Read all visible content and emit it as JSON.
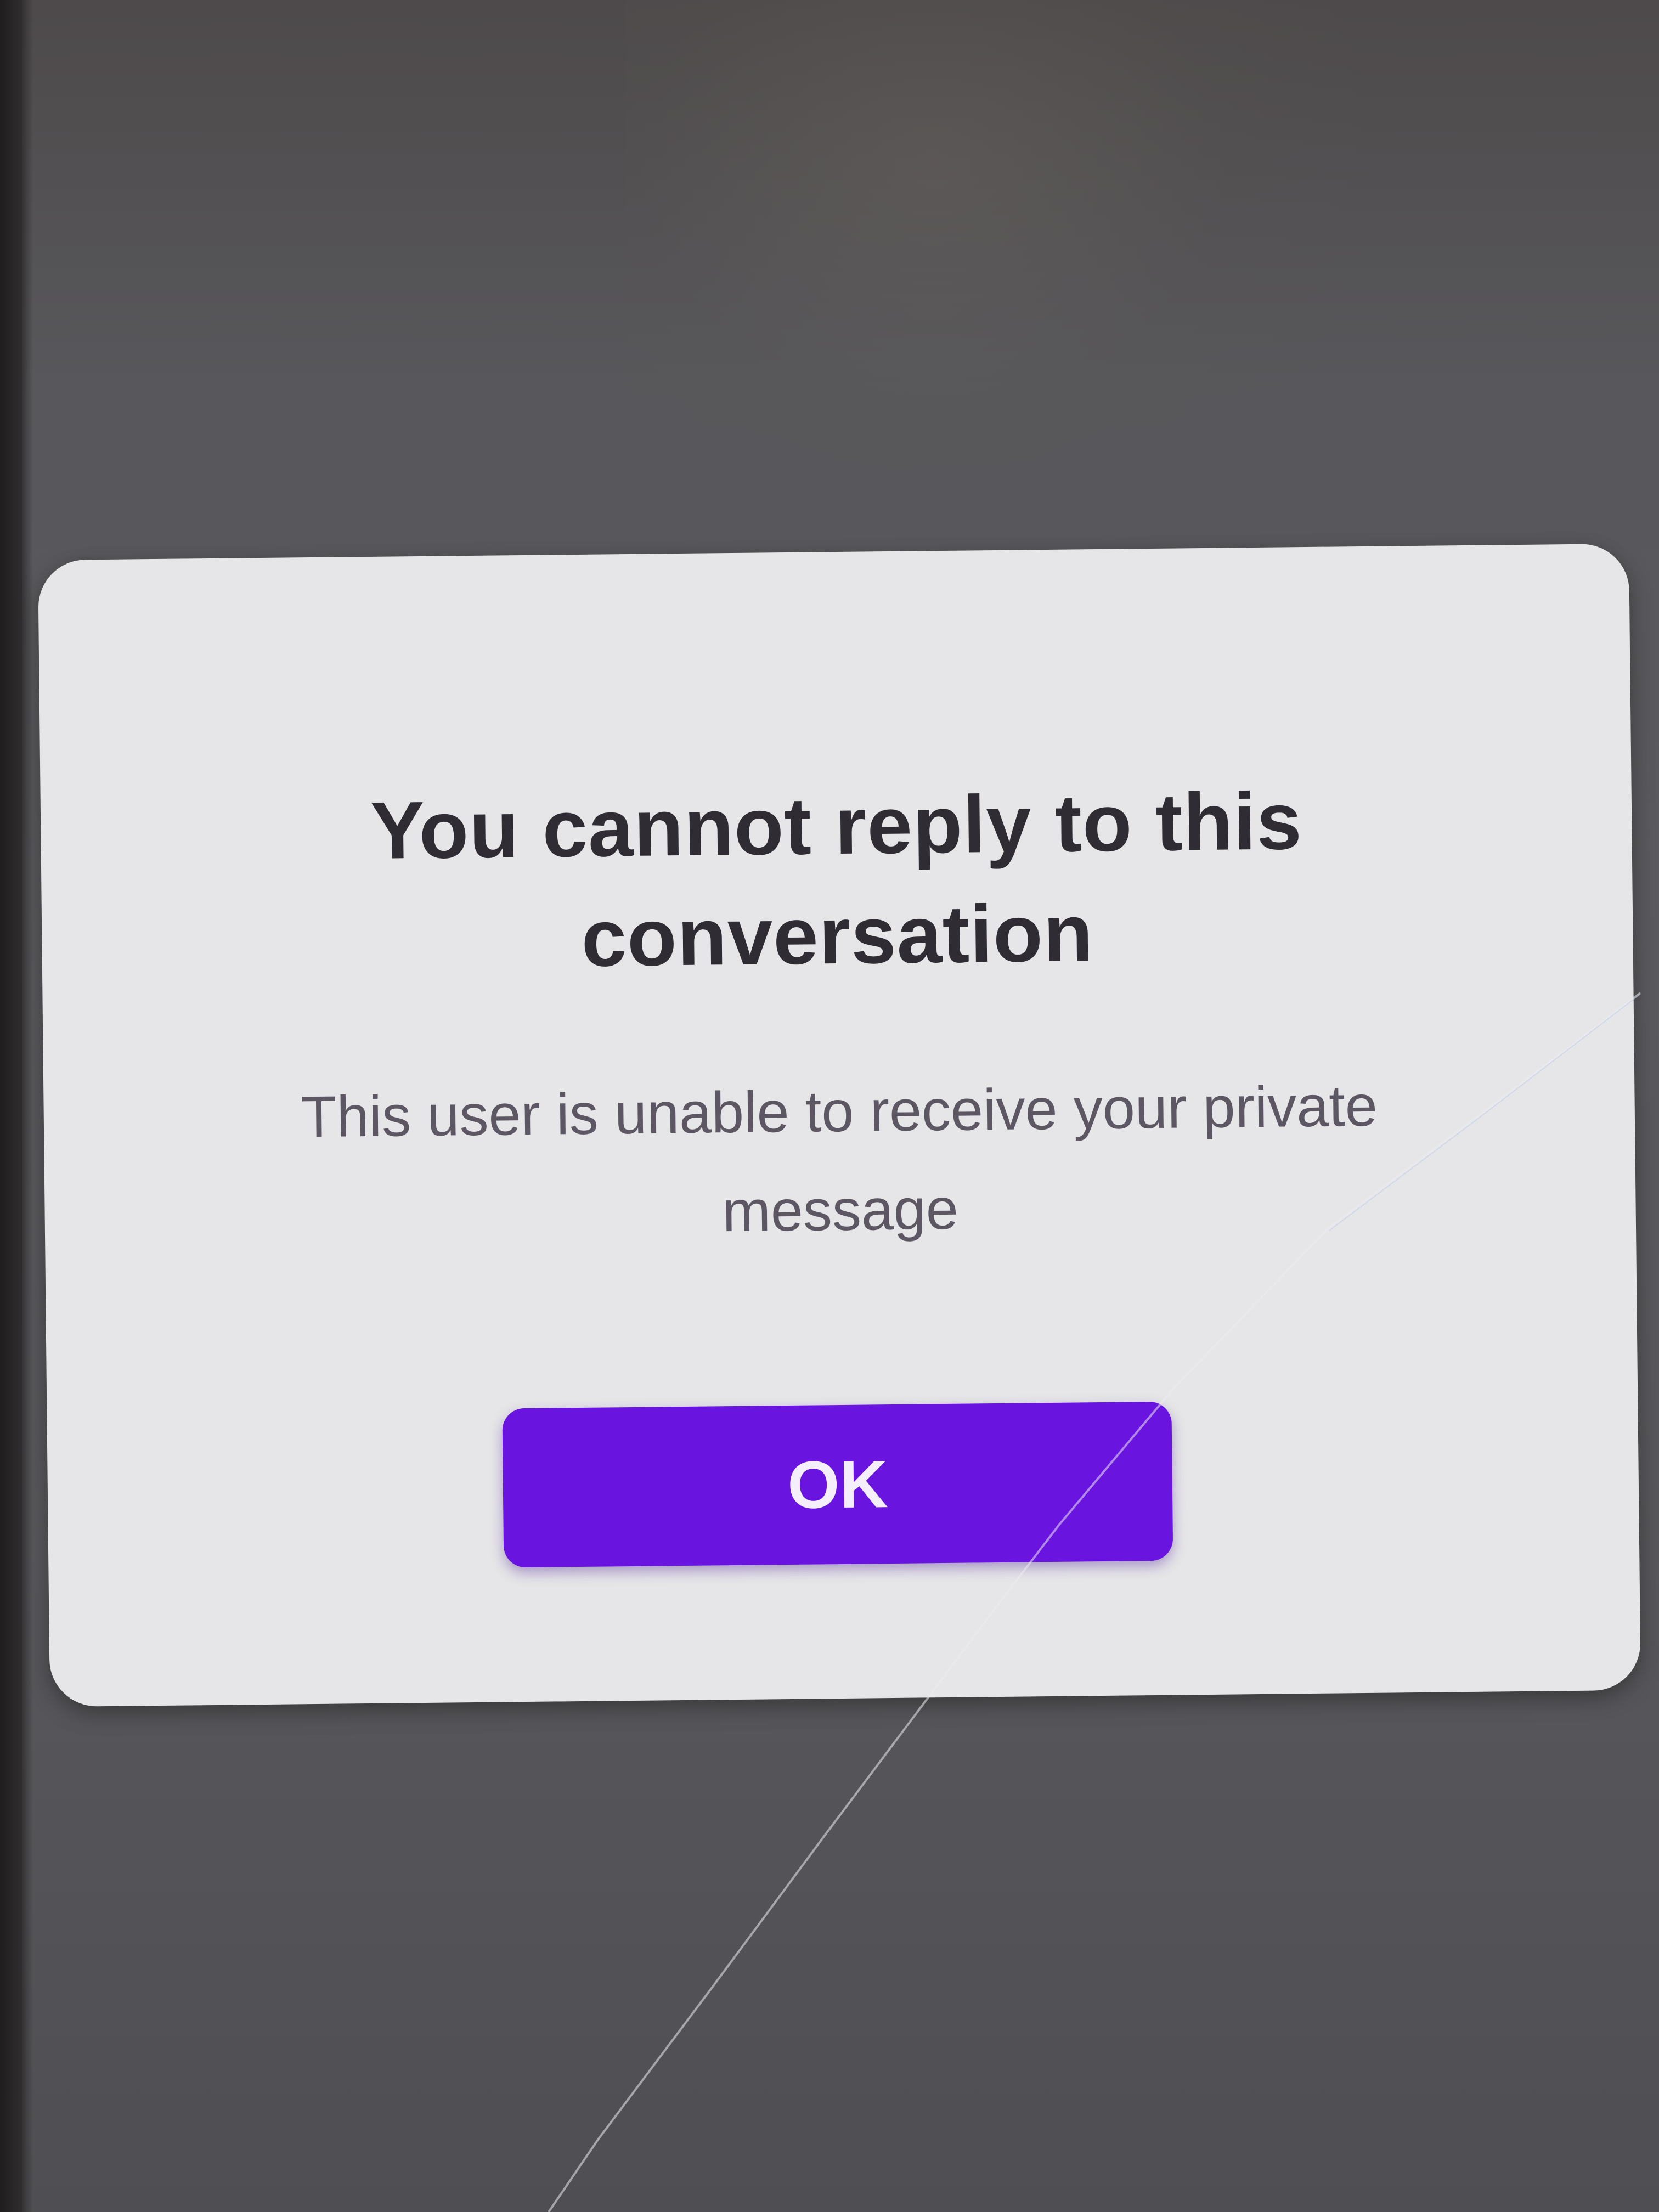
{
  "dialog": {
    "title": "You cannot reply to this conversation",
    "message": "This user is unable to receive your private message",
    "ok_label": "OK"
  },
  "colors": {
    "backdrop": "#58585c",
    "dialog_background": "#e6e6e8",
    "title_text": "#2f2c33",
    "message_text": "#5c5762",
    "button_background": "#6a14e0",
    "button_text": "#f4effb"
  }
}
